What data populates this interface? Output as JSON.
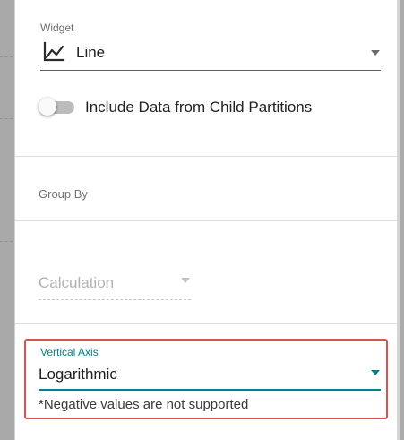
{
  "widget": {
    "label": "Widget",
    "selected": "Line",
    "icon": "line-chart-icon"
  },
  "child_partitions": {
    "label": "Include Data from Child Partitions",
    "enabled": false
  },
  "group_by": {
    "label": "Group By"
  },
  "calculation": {
    "placeholder": "Calculation",
    "disabled": true
  },
  "vertical_axis": {
    "label": "Vertical Axis",
    "selected": "Logarithmic",
    "helper": "*Negative values are not supported"
  },
  "colors": {
    "accent": "#00838f",
    "highlight_border": "#d9534f",
    "overlay": "#ababab"
  }
}
